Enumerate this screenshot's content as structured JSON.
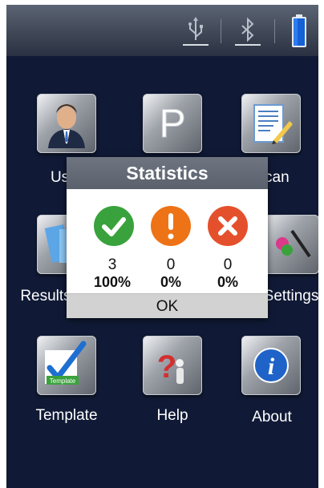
{
  "menu": {
    "items": [
      {
        "id": "user",
        "label": "User",
        "icon": "user-icon"
      },
      {
        "id": "p",
        "label": "",
        "icon": "parking-p-icon"
      },
      {
        "id": "scan",
        "label": "Scan",
        "icon": "scan-document-icon"
      },
      {
        "id": "results",
        "label": "Results",
        "icon": "results-icon"
      },
      {
        "id": "settings",
        "label": "Settings",
        "icon": "settings-tools-icon"
      },
      {
        "id": "template",
        "label": "Template",
        "icon": "template-check-icon"
      },
      {
        "id": "help",
        "label": "Help",
        "icon": "help-figure-icon"
      },
      {
        "id": "about",
        "label": "About",
        "icon": "info-icon"
      }
    ],
    "template_badge": "Template"
  },
  "status_bar": {
    "icons": [
      "usb-icon",
      "bluetooth-icon",
      "battery-icon"
    ]
  },
  "dialog": {
    "title": "Statistics",
    "stats": [
      {
        "type": "pass",
        "icon": "check-circle-icon",
        "color": "#3aa23c",
        "count": "3",
        "percent": "100%"
      },
      {
        "type": "warning",
        "icon": "exclamation-circle-icon",
        "color": "#ee7316",
        "count": "0",
        "percent": "0%"
      },
      {
        "type": "fail",
        "icon": "x-circle-icon",
        "color": "#e5502c",
        "count": "0",
        "percent": "0%"
      }
    ],
    "ok_label": "OK"
  },
  "colors": {
    "background": "#101a36",
    "status_bar": "#454d5c",
    "battery": "#1561d6"
  }
}
